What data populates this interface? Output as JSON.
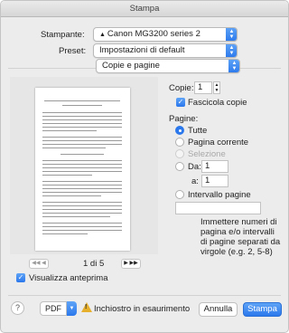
{
  "window": {
    "title": "Stampa"
  },
  "printer": {
    "label": "Stampante:",
    "value": "Canon MG3200 series 2"
  },
  "preset": {
    "label": "Preset:",
    "value": "Impostazioni di default"
  },
  "section": {
    "value": "Copie e pagine"
  },
  "preview": {
    "page_indicator": "1 di 5",
    "show_preview_label": "Visualizza anteprima",
    "show_preview_checked": true
  },
  "copies": {
    "label": "Copie:",
    "value": "1",
    "collate_label": "Fascicola copie",
    "collate_checked": true
  },
  "pages": {
    "label": "Pagine:",
    "options": {
      "all": "Tutte",
      "current": "Pagina corrente",
      "selection": "Selezione",
      "from": "Da:",
      "to": "a:",
      "range": "Intervallo pagine"
    },
    "selected": "all",
    "from_value": "1",
    "to_value": "1",
    "range_value": "",
    "range_help": "Immettere numeri di pagina e/o intervalli di pagine separati da virgole (e.g. 2, 5-8)"
  },
  "footer": {
    "help": "?",
    "pdf_label": "PDF",
    "ink_status": "Inchiostro in esaurimento",
    "cancel_label": "Annulla",
    "print_label": "Stampa"
  },
  "colors": {
    "accent": "#2b78ec",
    "warning": "#e6b02d"
  }
}
